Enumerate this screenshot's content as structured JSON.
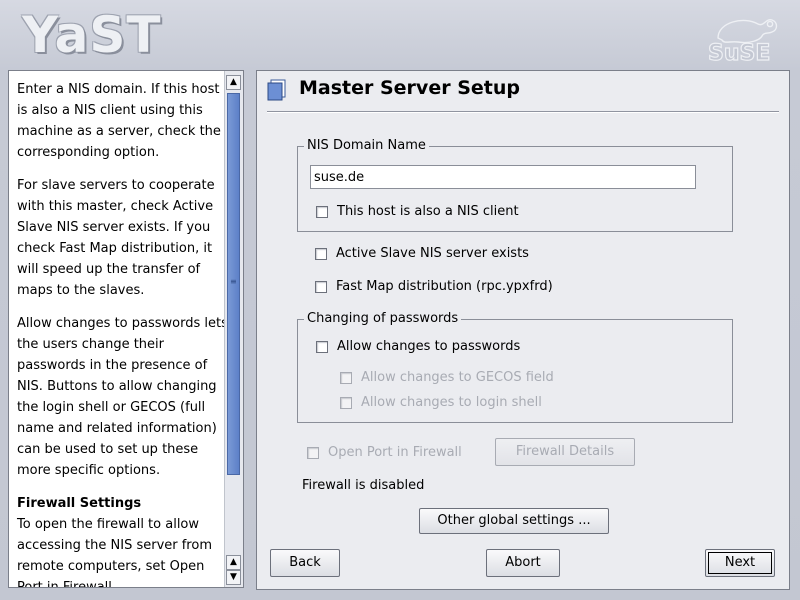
{
  "logo": {
    "text": "YaST"
  },
  "help": {
    "paragraphs": [
      "Enter a NIS domain. If this host is also a NIS client using this machine as a server, check the corresponding option.",
      "For slave servers to cooperate with this master, check Active Slave NIS server exists. If you check Fast Map distribution, it will speed up the transfer of maps to the slaves.",
      "Allow changes to passwords lets the users change their passwords in the presence of NIS. Buttons to allow changing the login shell or GECOS (full name and related information) can be used to set up these more specific options."
    ],
    "firewall_heading": "Firewall Settings",
    "firewall_text": "To open the firewall to allow accessing the NIS server from remote computers, set Open Port in Firewall."
  },
  "main": {
    "title": "Master Server Setup",
    "domain_group": {
      "legend": "NIS Domain Name",
      "value": "suse.de",
      "nis_client_label": "This host is also a NIS client"
    },
    "active_slave_label": "Active Slave NIS server exists",
    "fast_map_label": "Fast Map distribution (rpc.ypxfrd)",
    "password_group": {
      "legend": "Changing of passwords",
      "allow_changes_label": "Allow changes to passwords",
      "gecos_label": "Allow changes to GECOS field",
      "shell_label": "Allow changes to login shell"
    },
    "open_port_label": "Open Port in Firewall",
    "firewall_details_label": "Firewall Details",
    "firewall_status": "Firewall is disabled",
    "other_settings_label": "Other global settings ...",
    "back_label": "Back",
    "abort_label": "Abort",
    "next_label": "Next"
  },
  "colors": {
    "scroll_thumb": "#6a8ccf",
    "pane_bg": "#ebecf0"
  },
  "icons": [
    "suse-chameleon-icon",
    "dialog-icon",
    "scroll-up-icon",
    "scroll-down-icon"
  ]
}
